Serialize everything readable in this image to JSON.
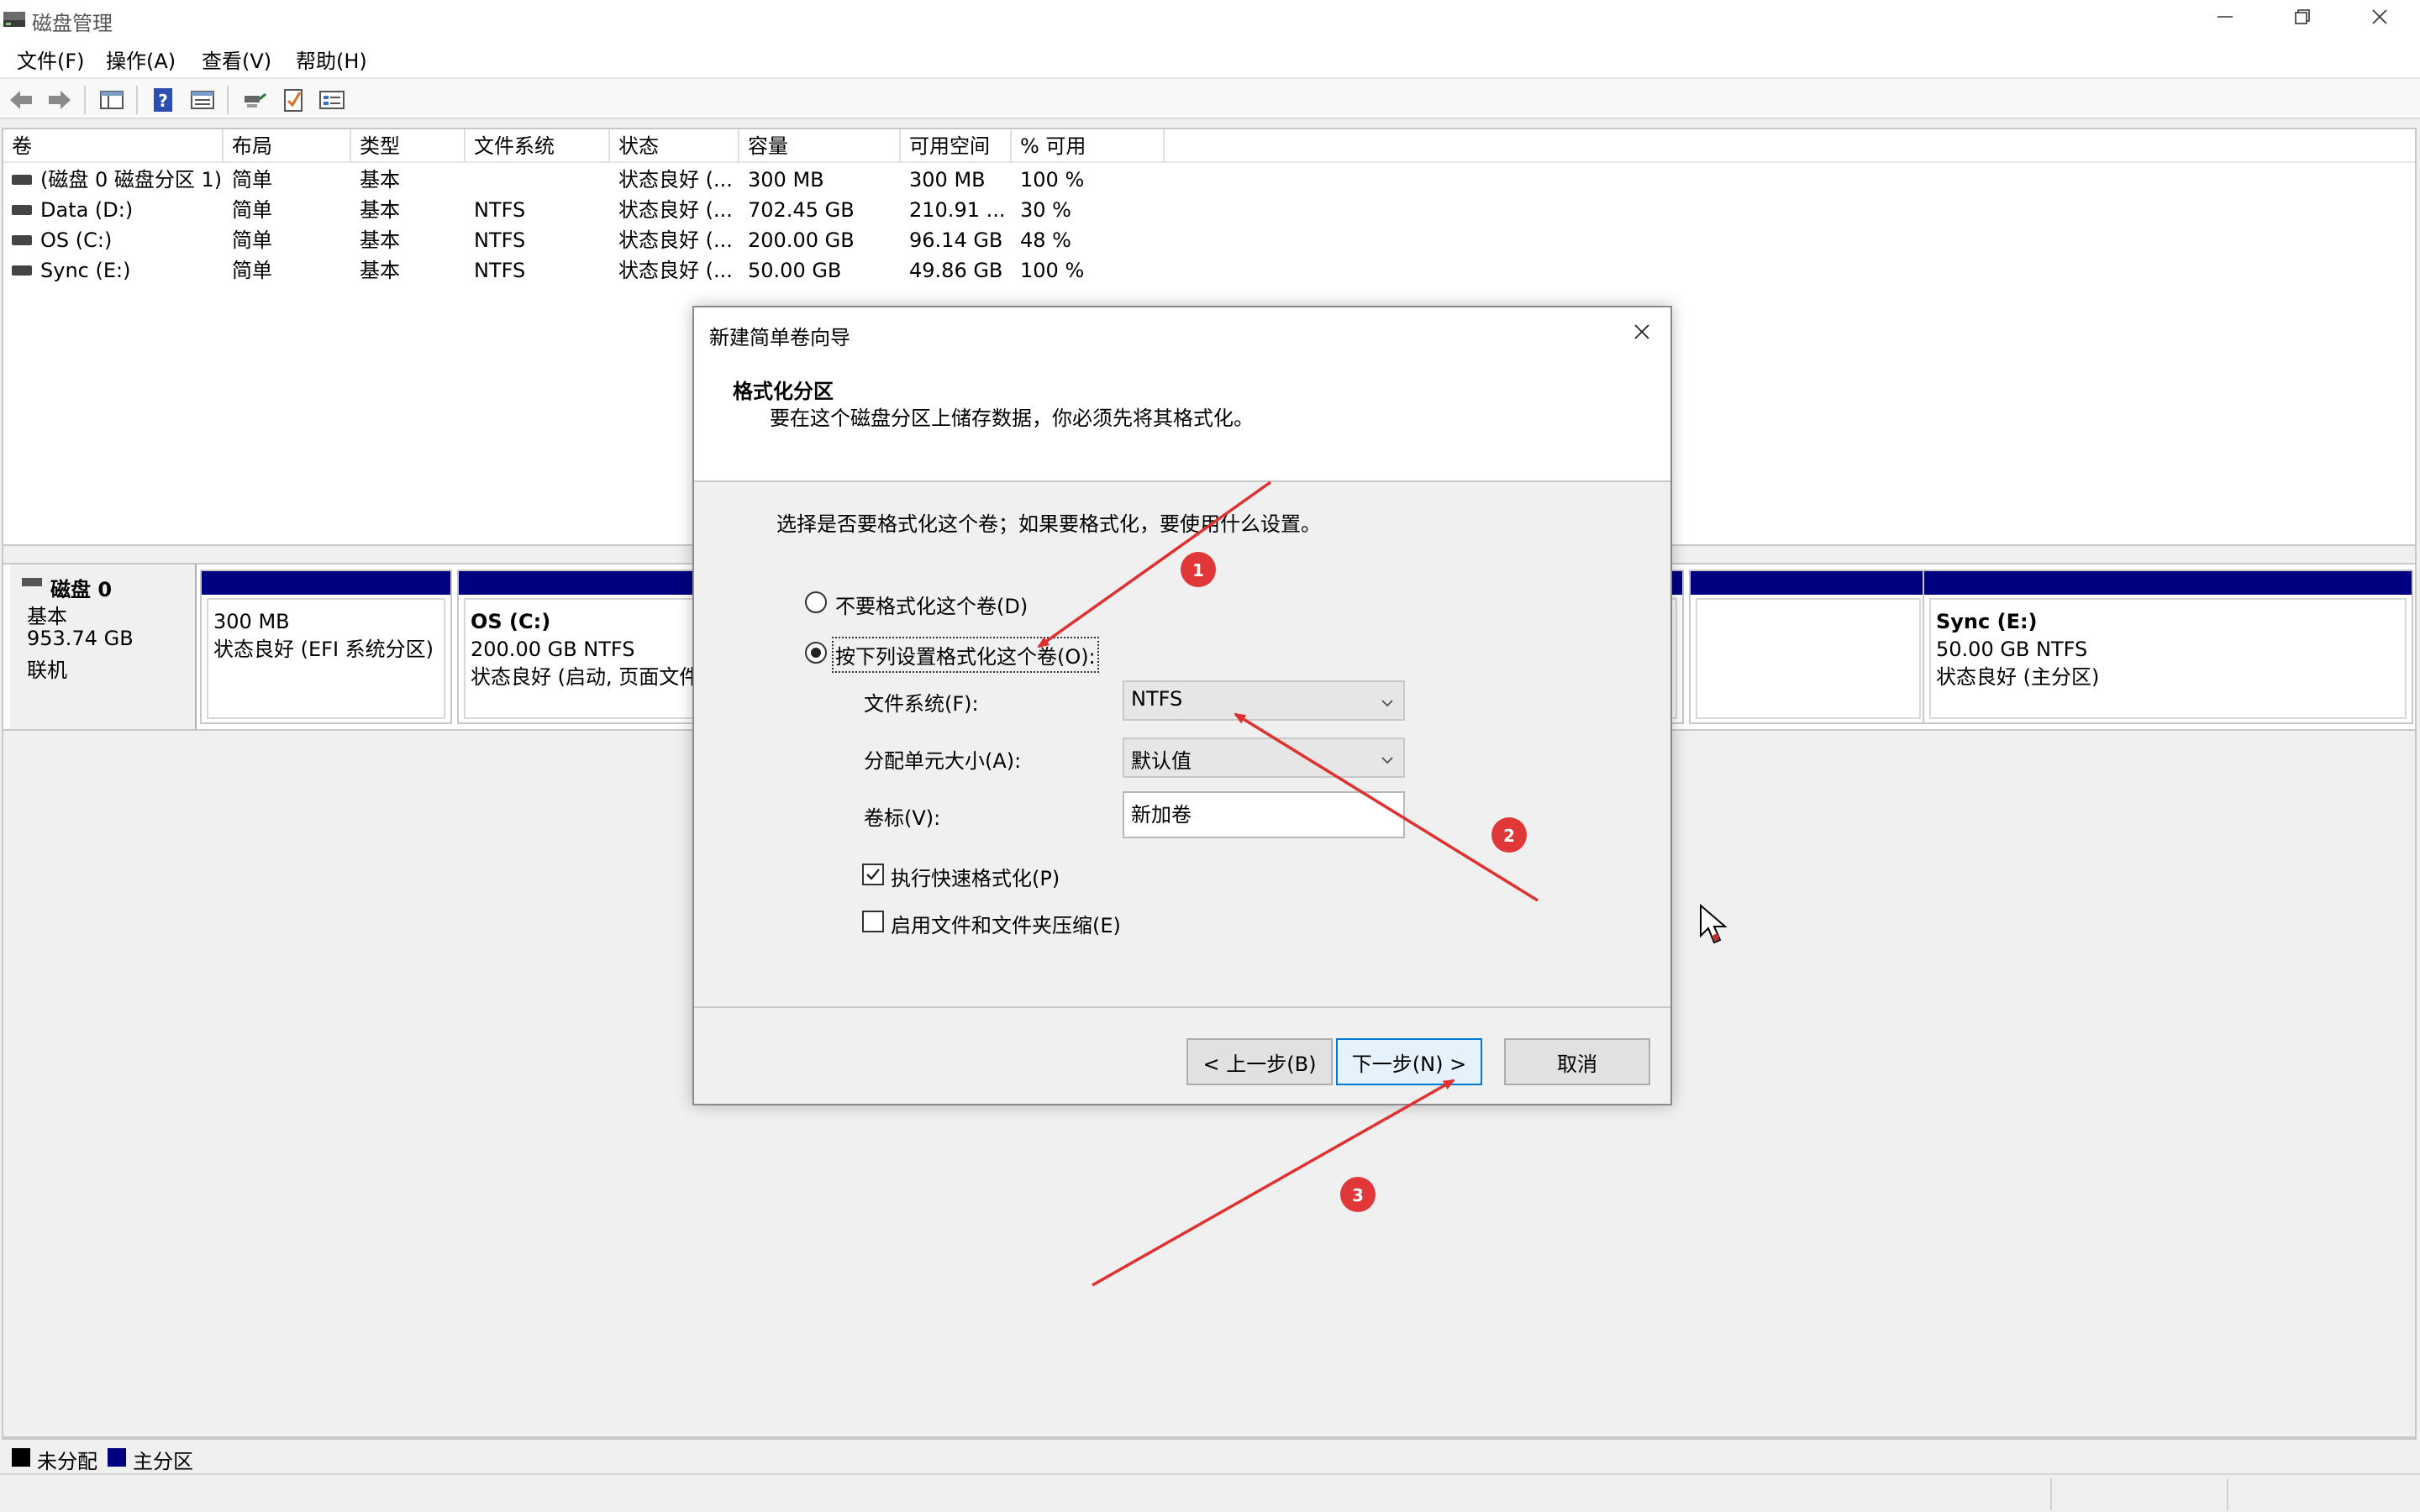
{
  "window": {
    "title": "磁盘管理",
    "icons": [
      "disk-management-app-icon",
      "minimize-icon",
      "restore-icon",
      "close-icon"
    ]
  },
  "menu": [
    "文件(F)",
    "操作(A)",
    "查看(V)",
    "帮助(H)"
  ],
  "toolbar": {
    "icons": [
      "back-arrow-icon",
      "forward-arrow-icon",
      "show-hide-console-tree-icon",
      "help-icon",
      "properties-icon",
      "connect-icon",
      "check-icon",
      "settings-list-icon"
    ]
  },
  "volume_table": {
    "columns": [
      "卷",
      "布局",
      "类型",
      "文件系统",
      "状态",
      "容量",
      "可用空间",
      "% 可用"
    ],
    "rows": [
      [
        "(磁盘 0 磁盘分区 1)",
        "简单",
        "基本",
        "",
        "状态良好 (...",
        "300 MB",
        "300 MB",
        "100 %"
      ],
      [
        "Data (D:)",
        "简单",
        "基本",
        "NTFS",
        "状态良好 (...",
        "702.45 GB",
        "210.91 ...",
        "30 %"
      ],
      [
        "OS (C:)",
        "简单",
        "基本",
        "NTFS",
        "状态良好 (...",
        "200.00 GB",
        "96.14 GB",
        "48 %"
      ],
      [
        "Sync (E:)",
        "简单",
        "基本",
        "NTFS",
        "状态良好 (...",
        "50.00 GB",
        "49.86 GB",
        "100 %"
      ]
    ]
  },
  "disk": {
    "name": "磁盘 0",
    "type": "基本",
    "size": "953.74 GB",
    "state": "联机",
    "partitions": [
      {
        "title": "",
        "line1": "300 MB",
        "line2": "状态良好 (EFI 系统分区)"
      },
      {
        "title": "OS  (C:)",
        "line1": "200.00 GB NTFS",
        "line2": "状态良好 (启动, 页面文件,"
      },
      {
        "title": "Sync  (E:)",
        "line1": "50.00 GB NTFS",
        "line2": "状态良好 (主分区)"
      }
    ]
  },
  "legend": {
    "unallocated": "未分配",
    "primary": "主分区",
    "unallocated_color": "#000000",
    "primary_color": "#000080"
  },
  "dialog": {
    "title": "新建简单卷向导",
    "heading": "格式化分区",
    "subheading": "要在这个磁盘分区上储存数据，你必须先将其格式化。",
    "prompt": "选择是否要格式化这个卷；如果要格式化，要使用什么设置。",
    "radio_no_format": "不要格式化这个卷(D)",
    "radio_format": "按下列设置格式化这个卷(O):",
    "fs_label": "文件系统(F):",
    "fs_value": "NTFS",
    "alloc_label": "分配单元大小(A):",
    "alloc_value": "默认值",
    "vol_label": "卷标(V):",
    "vol_value": "新加卷",
    "quick_format": "执行快速格式化(P)",
    "quick_format_checked": true,
    "compression": "启用文件和文件夹压缩(E)",
    "compression_checked": false,
    "back_button": "< 上一步(B)",
    "next_button": "下一步(N) >",
    "cancel_button": "取消"
  },
  "annotations": {
    "badges": [
      "1",
      "2",
      "3"
    ],
    "color": "#e03030"
  }
}
